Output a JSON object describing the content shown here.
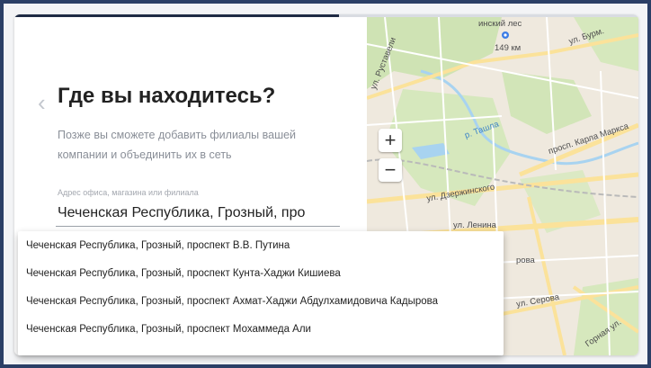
{
  "progress": {
    "fraction": 0.52
  },
  "header": {
    "back_icon": "chevron-left-icon",
    "title": "Где вы находитесь?",
    "subtitle": "Позже вы сможете добавить филиалы вашей компании и объединить их в сеть"
  },
  "address": {
    "label": "Адрес офиса, магазина или филиала",
    "value": "Чеченская Республика, Грозный, про"
  },
  "suggestions": [
    "Чеченская Республика, Грозный, проспект В.В. Путина",
    "Чеченская Республика, Грозный, проспект Кунта-Хаджи Кишиева",
    "Чеченская Республика, Грозный, проспект Ахмат-Хаджи Абдулхамидовича Кадырова",
    "Чеченская Республика, Грозный, проспект Мохаммеда Али"
  ],
  "map": {
    "zoom_in": "+",
    "zoom_out": "−",
    "labels": {
      "les": "инский лес",
      "km": "149 км",
      "burm": "ул. Бурм.",
      "rustaveli": "ул. Руставели",
      "tashla": "р. Ташла",
      "karla": "просп. Карла Маркса",
      "dzerzh": "ул. Дзержинского",
      "lenina": "ул. Ленина",
      "prova": "рова",
      "serova": "ул. Серова",
      "gornaya": "Горная ул."
    },
    "colors": {
      "water": "#a8d3f0",
      "park": "#cfe3b4",
      "road": "#fbe29a",
      "base": "#efe9de",
      "marker": "#3c7de6"
    }
  }
}
